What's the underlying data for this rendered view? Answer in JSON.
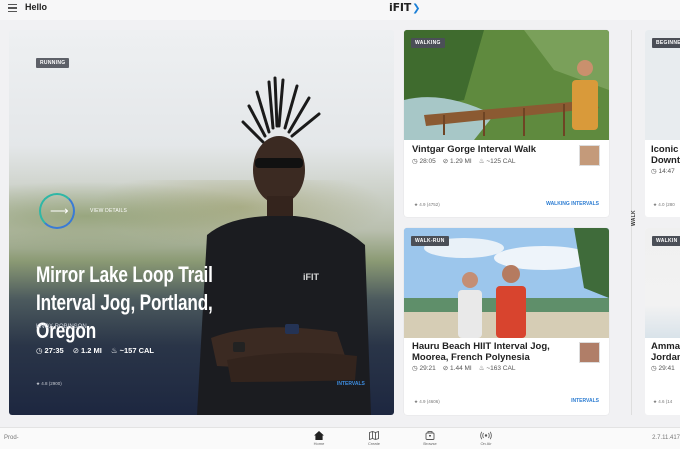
{
  "header": {
    "greeting": "Hello",
    "logo": "iFIT",
    "logo_arrow": "❯"
  },
  "hero": {
    "badge": "RUNNING",
    "view_details": "VIEW DETAILS",
    "title": "Mirror Lake Loop Trail Interval Jog, Portland, Oregon",
    "coach": "KNOX ROBINSON",
    "duration": "27:35",
    "distance": "1.2 MI",
    "calories": "~157 CAL",
    "rating": "★ 4.8 (2900)",
    "category": "INTERVALS"
  },
  "cards": [
    {
      "badge": "WALKING",
      "title": "Vintgar Gorge Interval Walk",
      "duration": "28:05",
      "distance": "1.29 MI",
      "calories": "~125 CAL",
      "rating": "★ 4.9 (4752)",
      "category": "WALKING INTERVALS"
    },
    {
      "badge": "WALK-RUN",
      "title_line1": "Hauru Beach HIIT Interval Jog,",
      "title_line2": "Moorea, French Polynesia",
      "duration": "29:21",
      "distance": "1.44 MI",
      "calories": "~163 CAL",
      "rating": "★ 4.9 (4606)",
      "category": "INTERVALS"
    }
  ],
  "side_label": "WALK",
  "partial_cards": [
    {
      "badge": "BEGINNE",
      "title_line1": "Iconic",
      "title_line2": "Downt",
      "duration": "14:47",
      "rating": "★ 4.0 (280"
    },
    {
      "badge": "WALKIN",
      "title_line1": "Amma",
      "title_line2": "Jordan",
      "duration": "29:41",
      "rating": "★ 4.6 (14"
    }
  ],
  "bottom": {
    "left_text": "Prod-",
    "right_text": "2.7.11.417",
    "nav": [
      {
        "label": "Home",
        "icon": "home-icon",
        "active": true
      },
      {
        "label": "Create",
        "icon": "map-icon",
        "active": false
      },
      {
        "label": "Browse",
        "icon": "browse-icon",
        "active": false
      },
      {
        "label": "On Air",
        "icon": "on-air-icon",
        "active": false
      }
    ]
  },
  "colors": {
    "accent": "#2d7dd2",
    "badge": "#4b4f57",
    "ring_teal": "#2fb7a6"
  }
}
